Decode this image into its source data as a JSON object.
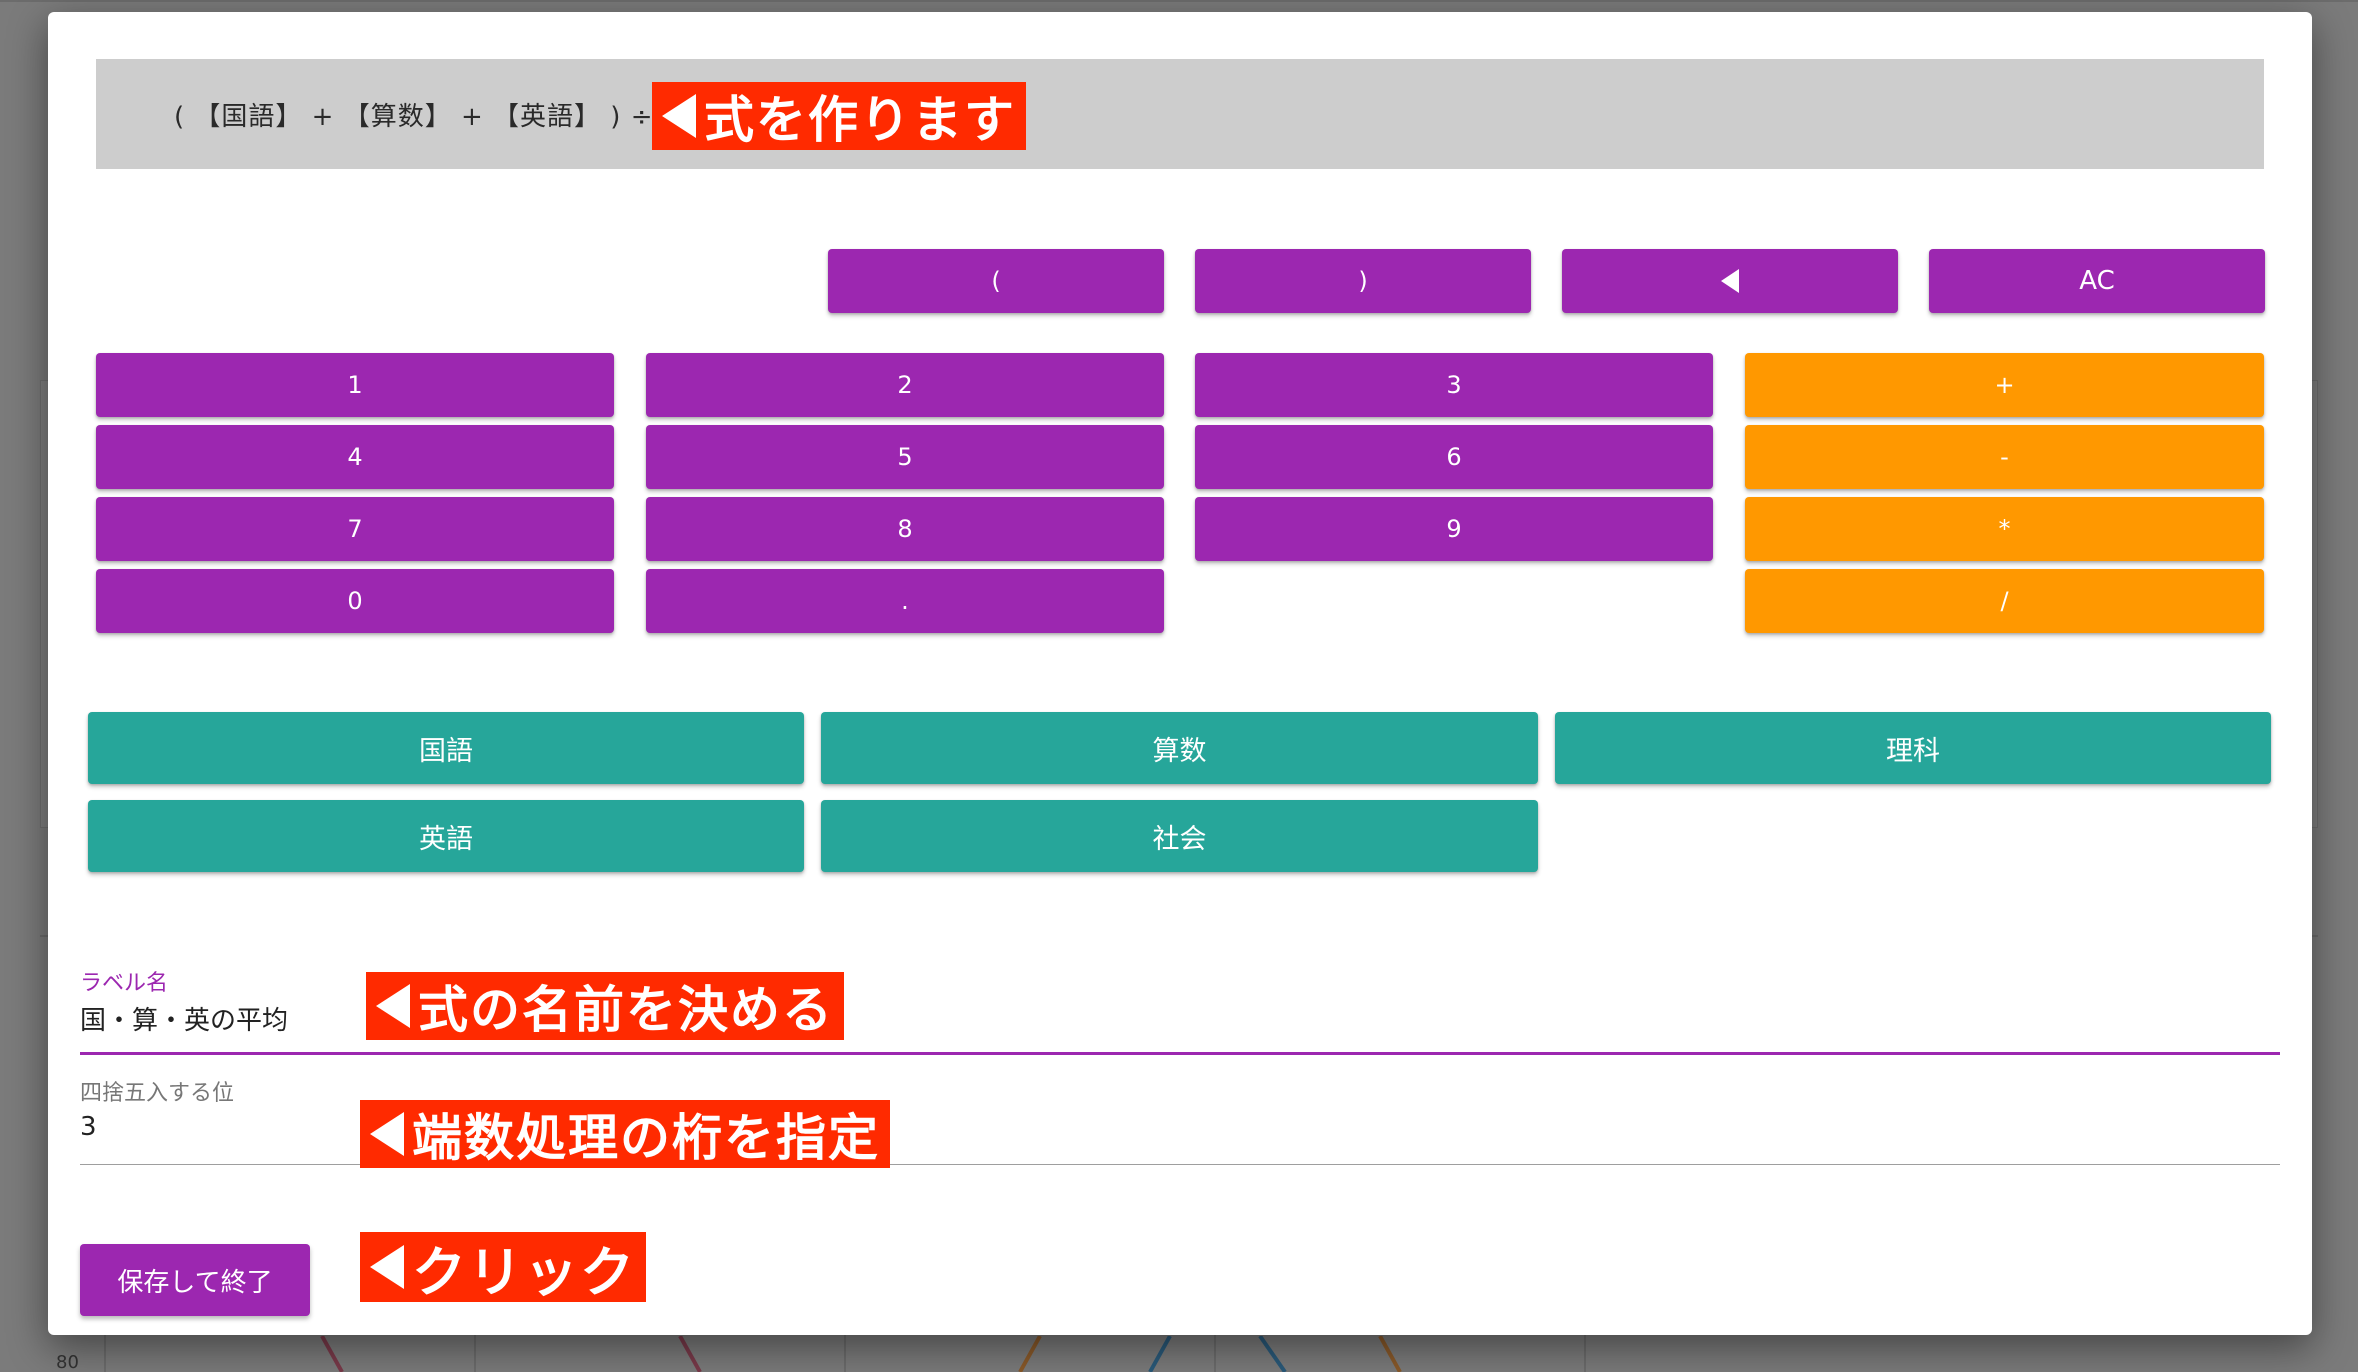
{
  "formula": {
    "expression": "( 【国語】 + 【算数】 + 【英語】 ) ÷ 3"
  },
  "annotations": {
    "formula_note": "式を作ります",
    "label_note": "式の名前を決める",
    "rounding_note": "端数処理の桁を指定",
    "click_note": "クリック"
  },
  "operators_top": [
    "(",
    ")",
    "backspace",
    "AC"
  ],
  "digits": [
    "1",
    "2",
    "3",
    "4",
    "5",
    "6",
    "7",
    "8",
    "9",
    "0",
    "."
  ],
  "operators": [
    "+",
    "-",
    "*",
    "/"
  ],
  "subjects": [
    "国語",
    "算数",
    "理科",
    "英語",
    "社会"
  ],
  "label_field": {
    "label": "ラベル名",
    "value": "国・算・英の平均"
  },
  "rounding_field": {
    "label": "四捨五入する位",
    "value": "3"
  },
  "save_button": {
    "label": "保存して終了"
  },
  "background": {
    "axis_tick": "80"
  },
  "colors": {
    "purple": "#9c27b0",
    "orange": "#ff9800",
    "teal": "#26a69a",
    "annotation_red": "#ff2a00"
  }
}
